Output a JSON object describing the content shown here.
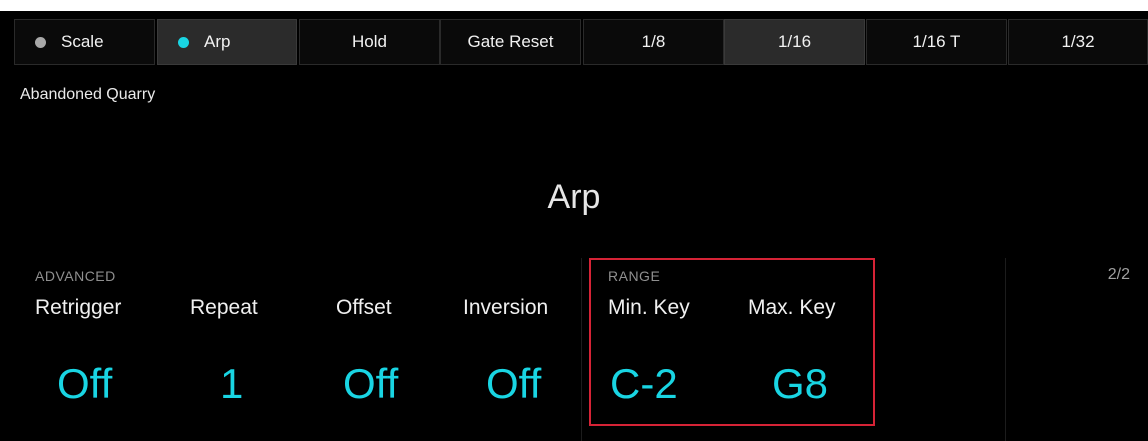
{
  "tabs": [
    {
      "label": "Scale",
      "indicator": "grey",
      "active": false
    },
    {
      "label": "Arp",
      "indicator": "cyan",
      "active": false
    },
    {
      "label": "Hold",
      "active": false
    },
    {
      "label": "Gate Reset",
      "active": false
    },
    {
      "label": "1/8",
      "active": false
    },
    {
      "label": "1/16",
      "active": true
    },
    {
      "label": "1/16 T",
      "active": false
    },
    {
      "label": "1/32",
      "active": false
    }
  ],
  "preset_name": "Abandoned Quarry",
  "mode_title": "Arp",
  "sections": {
    "advanced": {
      "label": "ADVANCED",
      "params": [
        {
          "label": "Retrigger",
          "value": "Off"
        },
        {
          "label": "Repeat",
          "value": "1"
        },
        {
          "label": "Offset",
          "value": "Off"
        },
        {
          "label": "Inversion",
          "value": "Off"
        }
      ]
    },
    "range": {
      "label": "RANGE",
      "params": [
        {
          "label": "Min. Key",
          "value": "C-2"
        },
        {
          "label": "Max. Key",
          "value": "G8"
        }
      ]
    }
  },
  "page_indicator": "2/2",
  "colors": {
    "accent": "#19d5e3",
    "highlight": "#d62336",
    "background": "#000000"
  }
}
